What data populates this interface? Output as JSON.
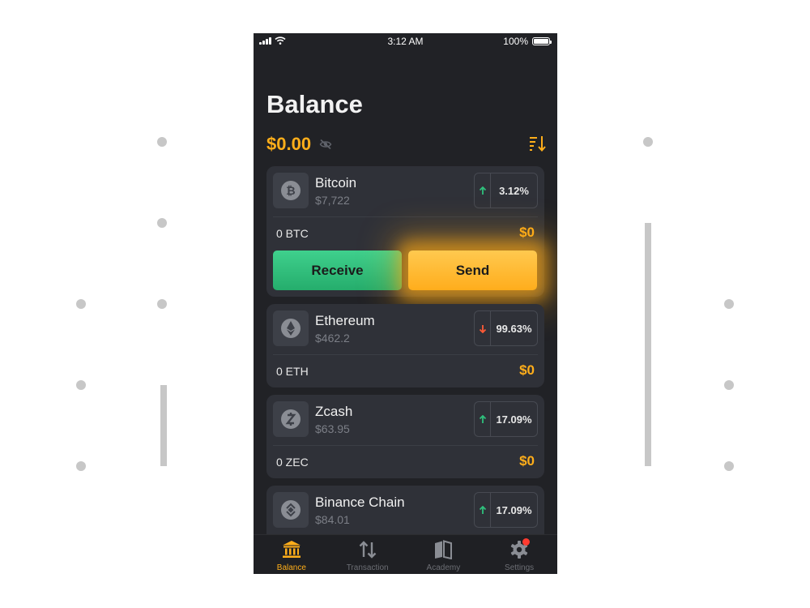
{
  "status_bar": {
    "time": "3:12 AM",
    "battery": "100%"
  },
  "page": {
    "title": "Balance",
    "total": "$0.00"
  },
  "coins": [
    {
      "name": "Bitcoin",
      "price": "$7,722",
      "change": "3.12%",
      "trend": "up",
      "holding": "0 BTC",
      "fiat": "$0",
      "icon": "bitcoin-icon"
    },
    {
      "name": "Ethereum",
      "price": "$462.2",
      "change": "99.63%",
      "trend": "down",
      "holding": "0 ETH",
      "fiat": "$0",
      "icon": "ethereum-icon"
    },
    {
      "name": "Zcash",
      "price": "$63.95",
      "change": "17.09%",
      "trend": "up",
      "holding": "0 ZEC",
      "fiat": "$0",
      "icon": "zcash-icon"
    },
    {
      "name": "Binance Chain",
      "price": "$84.01",
      "change": "17.09%",
      "trend": "up",
      "icon": "binance-icon"
    }
  ],
  "actions": {
    "receive": "Receive",
    "send": "Send"
  },
  "tabs": [
    {
      "label": "Balance",
      "icon": "bank-icon",
      "active": true
    },
    {
      "label": "Transaction",
      "icon": "transfer-arrows-icon",
      "active": false
    },
    {
      "label": "Academy",
      "icon": "book-icon",
      "active": false
    },
    {
      "label": "Settings",
      "icon": "gear-icon",
      "active": false,
      "badge": true
    }
  ],
  "colors": {
    "accent": "#ffae1a",
    "receive": "#2fc07c",
    "background": "#212226",
    "card": "#2f3138",
    "up": "#2fc07c",
    "down": "#ff5a36"
  }
}
